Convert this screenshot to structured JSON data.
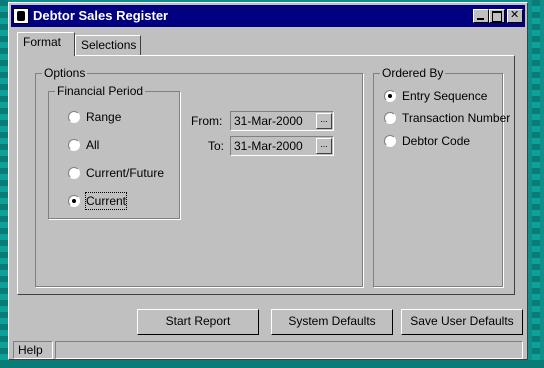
{
  "window": {
    "title": "Debtor Sales Register"
  },
  "tabs": [
    {
      "label": "Format"
    },
    {
      "label": "Selections"
    }
  ],
  "options": {
    "legend": "Options",
    "financial_period": {
      "legend": "Financial Period",
      "choices": [
        {
          "label": "Range",
          "selected": false
        },
        {
          "label": "All",
          "selected": false
        },
        {
          "label": "Current/Future",
          "selected": false
        },
        {
          "label": "Current",
          "selected": true
        }
      ]
    },
    "from": {
      "label": "From:",
      "value": "31-Mar-2000",
      "button": "..."
    },
    "to": {
      "label": "To:",
      "value": "31-Mar-2000",
      "button": "..."
    }
  },
  "ordered_by": {
    "legend": "Ordered By",
    "choices": [
      {
        "label": "Entry Sequence",
        "selected": true
      },
      {
        "label": "Transaction Number",
        "selected": false
      },
      {
        "label": "Debtor Code",
        "selected": false
      }
    ]
  },
  "buttons": {
    "start_report": "Start Report",
    "system_defaults": "System Defaults",
    "save_user_defaults": "Save User Defaults"
  },
  "status_bar": {
    "text": "Help"
  }
}
